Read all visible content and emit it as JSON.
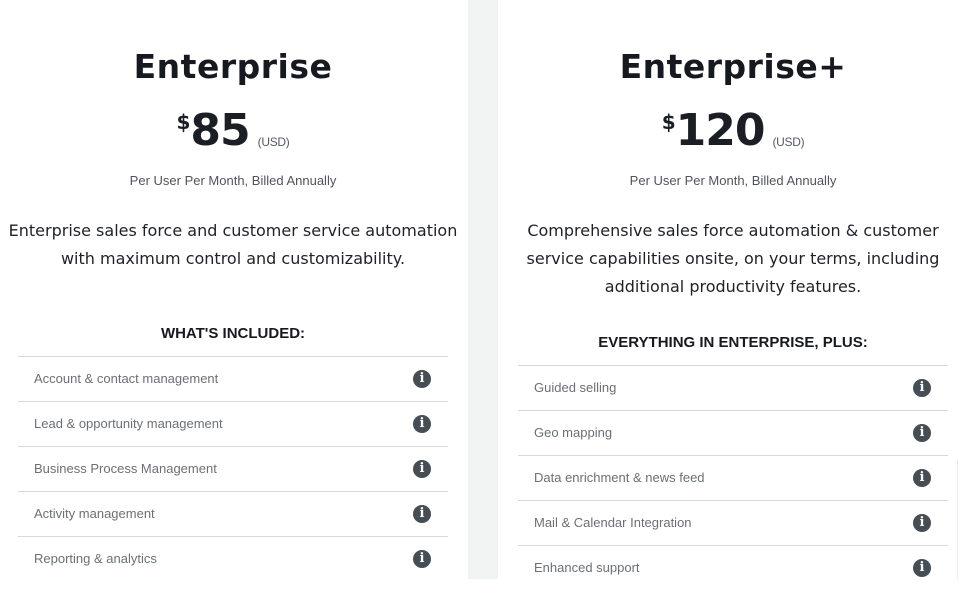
{
  "plans": [
    {
      "name": "Enterprise",
      "currency_symbol": "$",
      "price": "85",
      "currency_unit": "(USD)",
      "billing": "Per User Per Month, Billed Annually",
      "description": "Enterprise sales force and customer service automation with maximum control and customizability.",
      "features_heading": "WHAT'S INCLUDED:",
      "features": [
        {
          "label": "Account & contact management",
          "icon": "info-icon"
        },
        {
          "label": "Lead & opportunity management",
          "icon": "info-icon"
        },
        {
          "label": "Business Process Management",
          "icon": "info-icon"
        },
        {
          "label": "Activity management",
          "icon": "info-icon"
        },
        {
          "label": "Reporting & analytics",
          "icon": "info-icon"
        }
      ]
    },
    {
      "name": "Enterprise+",
      "currency_symbol": "$",
      "price": "120",
      "currency_unit": "(USD)",
      "billing": "Per User Per Month, Billed Annually",
      "description": "Comprehensive sales force automation & customer service capabilities onsite, on your terms, including additional productivity features.",
      "features_heading": "EVERYTHING IN ENTERPRISE, PLUS:",
      "features": [
        {
          "label": "Guided selling",
          "icon": "info-icon"
        },
        {
          "label": "Geo mapping",
          "icon": "info-icon"
        },
        {
          "label": "Data enrichment & news feed",
          "icon": "info-icon"
        },
        {
          "label": "Mail & Calendar Integration",
          "icon": "info-icon"
        },
        {
          "label": "Enhanced support",
          "icon": "info-icon"
        }
      ]
    }
  ],
  "icon_glyph": "i",
  "colors": {
    "text": "#16191f",
    "muted": "#6b7075",
    "icon_bg": "#454d55",
    "divider": "#d6d8da",
    "gap_bg": "#f2f3f3"
  }
}
